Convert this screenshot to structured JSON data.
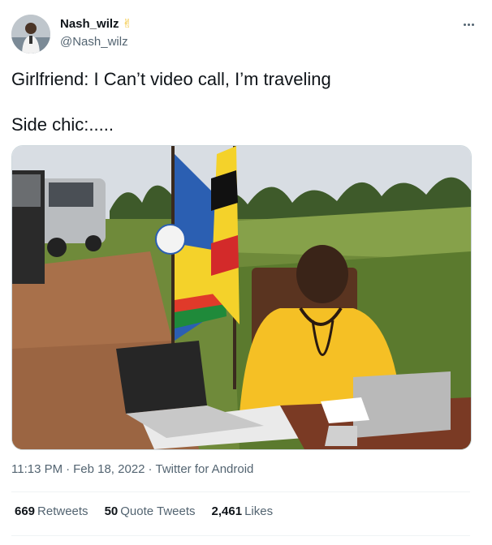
{
  "user": {
    "display_name": "Nash_wilz",
    "handle": "@Nash_wilz",
    "badge_emoji": "✌"
  },
  "tweet": {
    "line1": "Girlfriend: I Can’t video call, I’m traveling",
    "line2": "Side chic:....."
  },
  "meta": {
    "time": "11:13 PM",
    "date": "Feb 18, 2022",
    "source": "Twitter for Android",
    "separator": "·"
  },
  "stats": {
    "retweets_count": "669",
    "retweets_label": "Retweets",
    "quotes_count": "50",
    "quotes_label": "Quote Tweets",
    "likes_count": "2,461",
    "likes_label": "Likes"
  },
  "colors": {
    "text": "#0f1419",
    "secondary": "#536471",
    "border": "#eff3f4"
  },
  "icons": {
    "more": "more-horizontal-icon",
    "badge": "victory-hand-icon"
  }
}
